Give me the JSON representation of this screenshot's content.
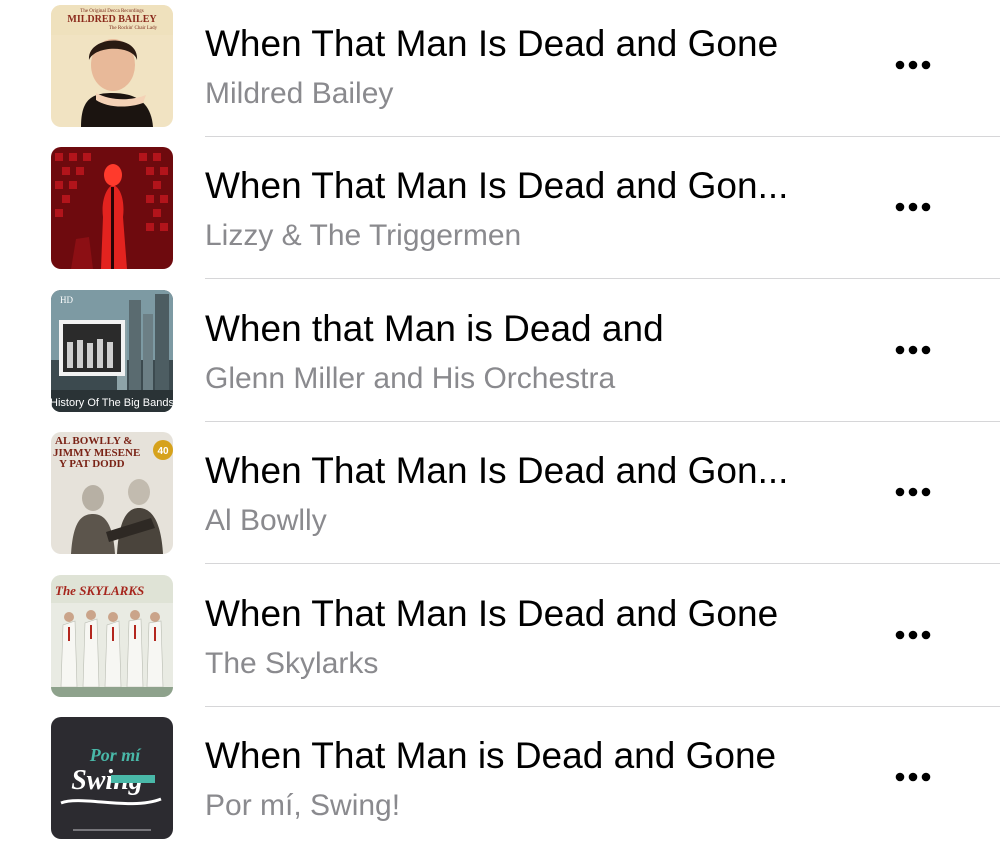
{
  "songs": [
    {
      "title": "When That Man Is Dead and Gone",
      "artist": "Mildred Bailey",
      "artwork_text": [
        "The Original Decca Recordings",
        "MILDRED BAILEY",
        "The Rockin' Chair Lady"
      ]
    },
    {
      "title": "When That Man Is Dead and Gon...",
      "artist": "Lizzy & The Triggermen"
    },
    {
      "title": "When that Man is Dead and",
      "artist": "Glenn Miller and His Orchestra",
      "artwork_text": [
        "History Of The Big Bands",
        "HD"
      ]
    },
    {
      "title": "When That Man Is Dead and Gon...",
      "artist": "Al Bowlly",
      "artwork_text": [
        "AL BOWLLY &",
        "JIMMY MESENE",
        "Y PAT DODD",
        "40"
      ]
    },
    {
      "title": "When That Man Is Dead and Gone",
      "artist": "The Skylarks",
      "artwork_text": [
        "The SKYLARKS"
      ]
    },
    {
      "title": "When That Man is Dead and Gone",
      "artist": "Por mí, Swing!",
      "artwork_text": [
        "Por mí",
        "Swing"
      ]
    }
  ],
  "more_icon": "ellipsis-horizontal-icon",
  "colors": {
    "title": "#000000",
    "subtitle": "#8a8a8e",
    "separator": "#d6d6d8",
    "background": "#ffffff"
  }
}
